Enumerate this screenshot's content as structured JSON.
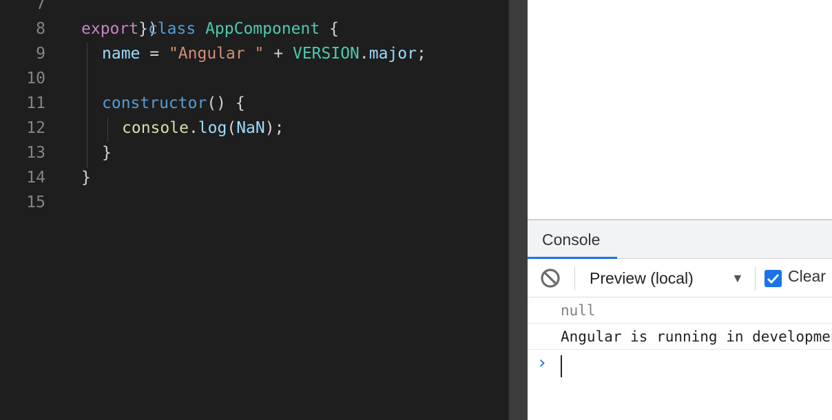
{
  "editor": {
    "lines": [
      {
        "number": "7",
        "tokens": [
          {
            "t": "})",
            "c": "punc"
          }
        ]
      },
      {
        "number": "8",
        "tokens": [
          {
            "t": "export",
            "c": "kw-ctl"
          },
          {
            "t": " ",
            "c": "punc"
          },
          {
            "t": "class",
            "c": "kw"
          },
          {
            "t": " ",
            "c": "punc"
          },
          {
            "t": "AppComponent",
            "c": "cls"
          },
          {
            "t": " {",
            "c": "punc"
          }
        ]
      },
      {
        "number": "9",
        "tokens": [
          {
            "t": "name",
            "c": "prop"
          },
          {
            "t": " = ",
            "c": "punc"
          },
          {
            "t": "\"Angular \"",
            "c": "str"
          },
          {
            "t": " + ",
            "c": "punc"
          },
          {
            "t": "VERSION",
            "c": "cls"
          },
          {
            "t": ".",
            "c": "punc"
          },
          {
            "t": "major",
            "c": "prop"
          },
          {
            "t": ";",
            "c": "punc"
          }
        ]
      },
      {
        "number": "10",
        "tokens": []
      },
      {
        "number": "11",
        "tokens": [
          {
            "t": "constructor",
            "c": "kw"
          },
          {
            "t": "() {",
            "c": "punc"
          }
        ]
      },
      {
        "number": "12",
        "tokens": [
          {
            "t": "console",
            "c": "fn"
          },
          {
            "t": ".",
            "c": "punc"
          },
          {
            "t": "log",
            "c": "prop"
          },
          {
            "t": "(",
            "c": "punc"
          },
          {
            "t": "NaN",
            "c": "prop"
          },
          {
            "t": ");",
            "c": "punc"
          }
        ]
      },
      {
        "number": "13",
        "tokens": [
          {
            "t": "}",
            "c": "punc"
          }
        ]
      },
      {
        "number": "14",
        "tokens": [
          {
            "t": "}",
            "c": "punc"
          }
        ]
      },
      {
        "number": "15",
        "tokens": []
      }
    ]
  },
  "console": {
    "tab_label": "Console",
    "clear_icon": "block-icon",
    "context_value": "Preview (local)",
    "context_arrow": "▼",
    "preserve_checked": true,
    "preserve_label": "Clear",
    "messages": [
      {
        "text": "null",
        "kind": "null"
      },
      {
        "text": "Angular is running in development mode. Call enableProdMode() to enable production mode.",
        "kind": "log"
      }
    ],
    "prompt_glyph": "›"
  },
  "colors": {
    "editor_bg": "#1e1e1e",
    "accent": "#1a73e8"
  }
}
